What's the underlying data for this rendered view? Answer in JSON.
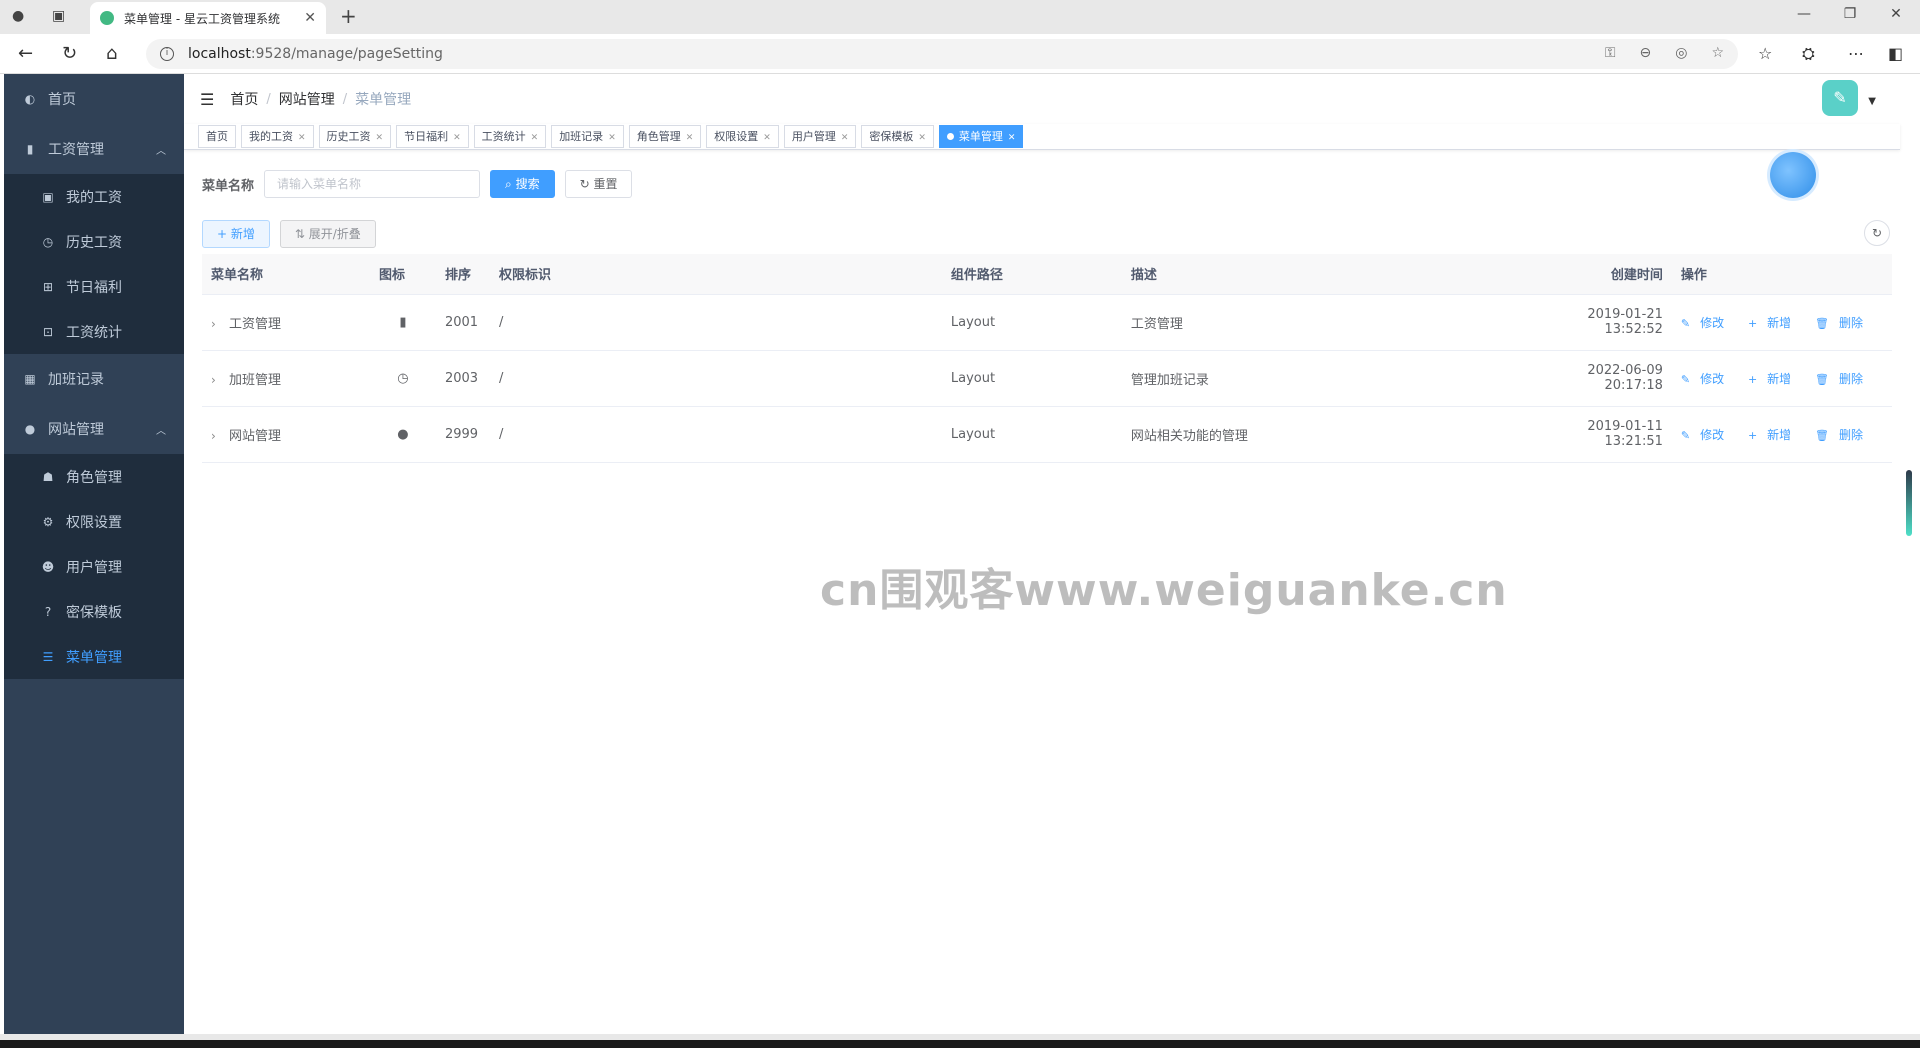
{
  "browser": {
    "tab_title": "菜单管理 - 星云工资管理系统",
    "url_host": "localhost",
    "url_path": ":9528/manage/pageSetting"
  },
  "sidebar": {
    "items": [
      {
        "label": "首页",
        "icon": "dashboard-icon"
      },
      {
        "label": "工资管理",
        "icon": "chart-icon",
        "expanded": true
      },
      {
        "label": "我的工资",
        "icon": "money-icon"
      },
      {
        "label": "历史工资",
        "icon": "clock-icon"
      },
      {
        "label": "节日福利",
        "icon": "gift-icon"
      },
      {
        "label": "工资统计",
        "icon": "stats-icon"
      },
      {
        "label": "加班记录",
        "icon": "calendar-icon"
      },
      {
        "label": "网站管理",
        "icon": "globe-icon",
        "expanded": true
      },
      {
        "label": "角色管理",
        "icon": "peoples-icon"
      },
      {
        "label": "权限设置",
        "icon": "gear-icon"
      },
      {
        "label": "用户管理",
        "icon": "user-icon"
      },
      {
        "label": "密保模板",
        "icon": "question-icon"
      },
      {
        "label": "菜单管理",
        "icon": "list-icon",
        "active": true
      }
    ]
  },
  "breadcrumb": [
    "首页",
    "网站管理",
    "菜单管理"
  ],
  "tags": [
    "首页",
    "我的工资",
    "历史工资",
    "节日福利",
    "工资统计",
    "加班记录",
    "角色管理",
    "权限设置",
    "用户管理",
    "密保模板",
    "菜单管理"
  ],
  "search": {
    "label": "菜单名称",
    "placeholder": "请输入菜单名称",
    "search_btn": "搜索",
    "reset_btn": "重置"
  },
  "actions": {
    "add_btn": "新增",
    "toggle_btn": "展开/折叠"
  },
  "table": {
    "headers": [
      "菜单名称",
      "图标",
      "排序",
      "权限标识",
      "组件路径",
      "描述",
      "创建时间",
      "操作"
    ],
    "rows": [
      {
        "name": "工资管理",
        "icon": "▮",
        "sort": "2001",
        "perm": "/",
        "component": "Layout",
        "desc": "工资管理",
        "created": "2019-01-21 13:52:52"
      },
      {
        "name": "加班管理",
        "icon": "◷",
        "sort": "2003",
        "perm": "/",
        "component": "Layout",
        "desc": "管理加班记录",
        "created": "2022-06-09 20:17:18"
      },
      {
        "name": "网站管理",
        "icon": "●",
        "sort": "2999",
        "perm": "/",
        "component": "Layout",
        "desc": "网站相关功能的管理",
        "created": "2019-01-11 13:21:51"
      }
    ],
    "ops": {
      "edit": "修改",
      "add": "新增",
      "delete": "删除"
    }
  },
  "watermark": "cn围观客www.weiguanke.cn",
  "colors": {
    "primary": "#409eff",
    "sidebar": "#304156",
    "submenu": "#1f2d3d"
  }
}
